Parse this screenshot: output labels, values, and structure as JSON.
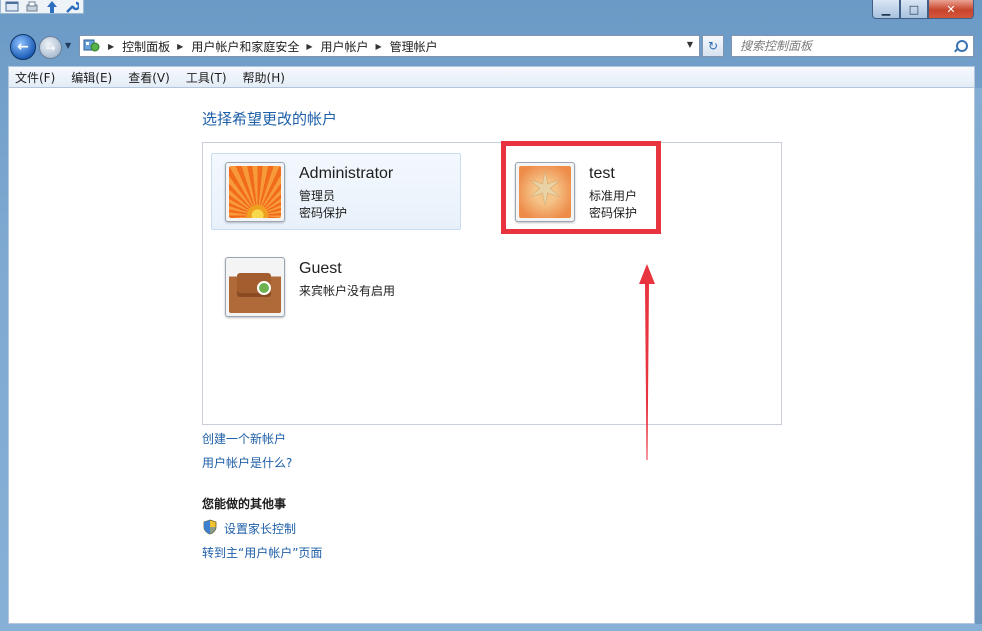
{
  "window": {
    "caption_buttons": {
      "minimize": "▁",
      "maximize": "□",
      "close": "✕"
    }
  },
  "navigation": {
    "breadcrumbs": [
      "控制面板",
      "用户帐户和家庭安全",
      "用户帐户",
      "管理帐户"
    ],
    "search_placeholder": "搜索控制面板"
  },
  "menu": {
    "items": [
      "文件(F)",
      "编辑(E)",
      "查看(V)",
      "工具(T)",
      "帮助(H)"
    ]
  },
  "main": {
    "heading": "选择希望更改的帐户",
    "accounts": [
      {
        "name": "Administrator",
        "type": "管理员",
        "status": "密码保护",
        "picture": "orange-flower"
      },
      {
        "name": "test",
        "type": "标准用户",
        "status": "密码保护",
        "picture": "starfish"
      },
      {
        "name": "Guest",
        "type": "来宾帐户没有启用",
        "status": "",
        "picture": "suitcase"
      }
    ],
    "links": {
      "create_account": "创建一个新帐户",
      "what_is_account": "用户帐户是什么?"
    },
    "other_tasks_title": "您能做的其他事",
    "other_tasks": {
      "parental_controls": "设置家长控制",
      "goto_main": "转到主“用户帐户”页面"
    }
  },
  "annotations": {
    "highlight_color": "#e8343f"
  }
}
